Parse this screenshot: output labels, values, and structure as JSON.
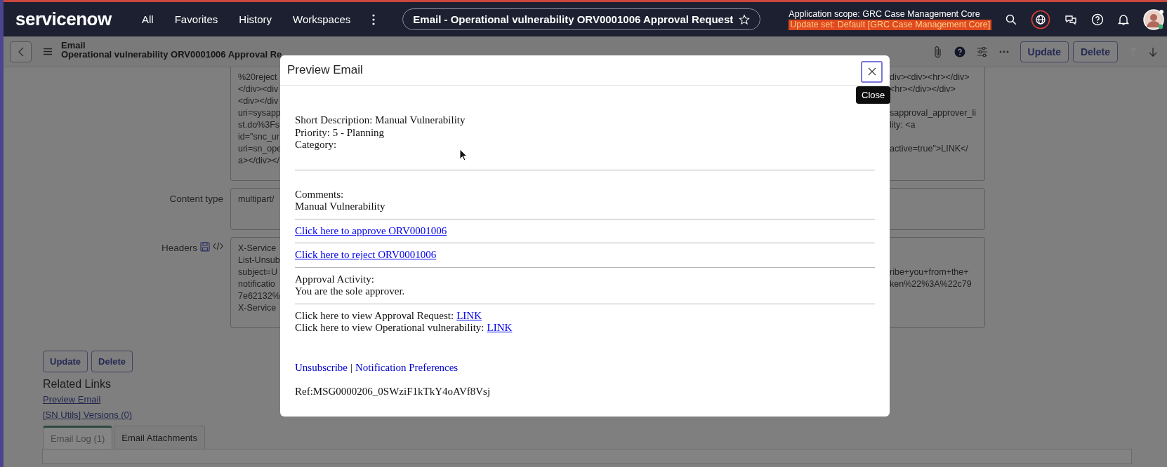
{
  "top_bar": {
    "logo": "servicenow",
    "nav": [
      "All",
      "Favorites",
      "History",
      "Workspaces"
    ],
    "title": "Email - Operational vulnerability ORV0001006 Approval Request",
    "scope": "Application scope: GRC Case Management Core",
    "update_set": "Update set: Default [GRC Case Management Core]"
  },
  "record_header": {
    "table": "Email",
    "title": "Operational vulnerability ORV0001006 Approval Re",
    "buttons": [
      "Update",
      "Delete"
    ]
  },
  "form": {
    "fields": [
      {
        "kind": "body",
        "lines": [
          {
            "left": "%20reject",
            "right": "div><div><hr></div>"
          },
          {
            "left": "</div><div",
            "right": "<hr></div></div>"
          },
          {
            "left": "<div></div"
          },
          {
            "left": "uri=sysapp",
            "right": "sapproval_approver_li"
          },
          {
            "left": "st.do%3Fs",
            "right": "lity: <a"
          },
          {
            "left": "id=\"snc_ur"
          },
          {
            "left": "uri=sn_ope",
            "right": "active=true\">LINK</"
          },
          {
            "left": "a></div></"
          }
        ]
      },
      {
        "kind": "content_type",
        "label": "Content type",
        "lines": [
          {
            "left": "multipart/"
          }
        ]
      },
      {
        "kind": "headers",
        "label": "Headers",
        "lines": [
          {
            "left": "X-Service"
          },
          {
            "left": "List-Unsub"
          },
          {
            "left": "subject=U",
            "right": "ribe+you+from+the+"
          },
          {
            "left": "notificatio",
            "right": "ken%22%3A%22c79"
          },
          {
            "left": "7e62132%"
          },
          {
            "left": "X-Service"
          }
        ]
      }
    ],
    "buttons": [
      "Update",
      "Delete"
    ]
  },
  "related_links": {
    "title": "Related Links",
    "links": [
      "Preview Email",
      "[SN Utils] Versions (0)"
    ]
  },
  "tabs": [
    {
      "label": "Email Log (1)",
      "selected": true
    },
    {
      "label": "Email Attachments",
      "selected": false
    }
  ],
  "modal": {
    "title": "Preview Email",
    "close_tooltip": "Close",
    "blocks": [
      {
        "rule": true,
        "lines": [
          {
            "text": "Short Description: Manual Vulnerability"
          },
          {
            "text": "Priority: 5 - Planning"
          },
          {
            "text": "Category:"
          }
        ]
      },
      {
        "rule": true,
        "lines": [
          {
            "text": "Comments:"
          },
          {
            "text": "Manual Vulnerability"
          }
        ]
      },
      {
        "rule": true,
        "lines": [
          {
            "link": "Click here to approve ORV0001006"
          }
        ]
      },
      {
        "rule": true,
        "lines": [
          {
            "link": "Click here to reject ORV0001006"
          }
        ]
      },
      {
        "rule": true,
        "lines": [
          {
            "text": "Approval Activity:"
          },
          {
            "text": "You are the sole approver."
          }
        ]
      },
      {
        "rule": false,
        "lines": [
          {
            "text": "Click here to view Approval Request:",
            "link": "LINK"
          },
          {
            "text": "Click here to view Operational vulnerability:",
            "link": "LINK"
          }
        ]
      }
    ],
    "footer": {
      "links": [
        "Unsubscribe",
        "Notification Preferences"
      ],
      "separator": "|",
      "ref": "Ref:MSG0000206_0SWziF1kTkY4oAVf8Vsj"
    }
  }
}
